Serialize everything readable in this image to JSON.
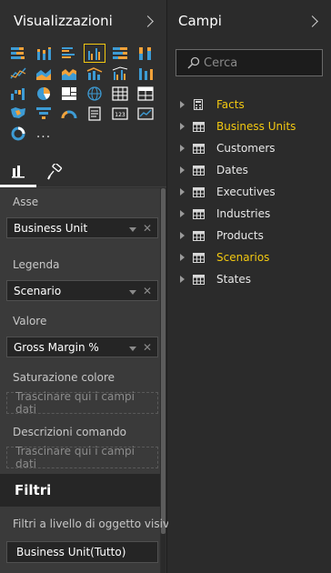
{
  "visualizations": {
    "title": "Visualizzazioni",
    "more_label": "...",
    "tabs": [
      {
        "name": "fields-tab",
        "icon": "bar-chart-icon",
        "active": true
      },
      {
        "name": "format-tab",
        "icon": "paint-roller-icon",
        "active": false
      }
    ],
    "selected_visual": "clustered-column-chart-icon"
  },
  "wells": {
    "axis_label": "Asse",
    "axis_value": "Business Unit",
    "legend_label": "Legenda",
    "legend_value": "Scenario",
    "value_label": "Valore",
    "value_value": "Gross Margin %",
    "color_saturation_label": "Saturazione colore",
    "color_saturation_placeholder": "Trascinare qui i campi dati",
    "tooltips_label": "Descrizioni comando",
    "tooltips_placeholder": "Trascinare qui i campi dati"
  },
  "filters": {
    "title": "Filtri",
    "visual_level_label": "Filtri a livello di oggetto visivo",
    "chips": [
      {
        "label": "Business Unit(Tutto)"
      }
    ]
  },
  "fields": {
    "title": "Campi",
    "search_placeholder": "Cerca",
    "tables": [
      {
        "name": "Facts",
        "icon": "calculator-icon",
        "highlighted": true
      },
      {
        "name": "Business Units",
        "icon": "table-icon",
        "highlighted": true
      },
      {
        "name": "Customers",
        "icon": "table-icon",
        "highlighted": false
      },
      {
        "name": "Dates",
        "icon": "table-icon",
        "highlighted": false
      },
      {
        "name": "Executives",
        "icon": "table-icon",
        "highlighted": false
      },
      {
        "name": "Industries",
        "icon": "table-icon",
        "highlighted": false
      },
      {
        "name": "Products",
        "icon": "table-icon",
        "highlighted": false
      },
      {
        "name": "Scenarios",
        "icon": "table-icon",
        "highlighted": true
      },
      {
        "name": "States",
        "icon": "table-icon",
        "highlighted": false
      }
    ]
  },
  "colors": {
    "highlight": "#f2c811",
    "viz_blue": "#3d9bd4",
    "viz_orange": "#f2a23a",
    "pane_bg": "#2f2f2f"
  }
}
